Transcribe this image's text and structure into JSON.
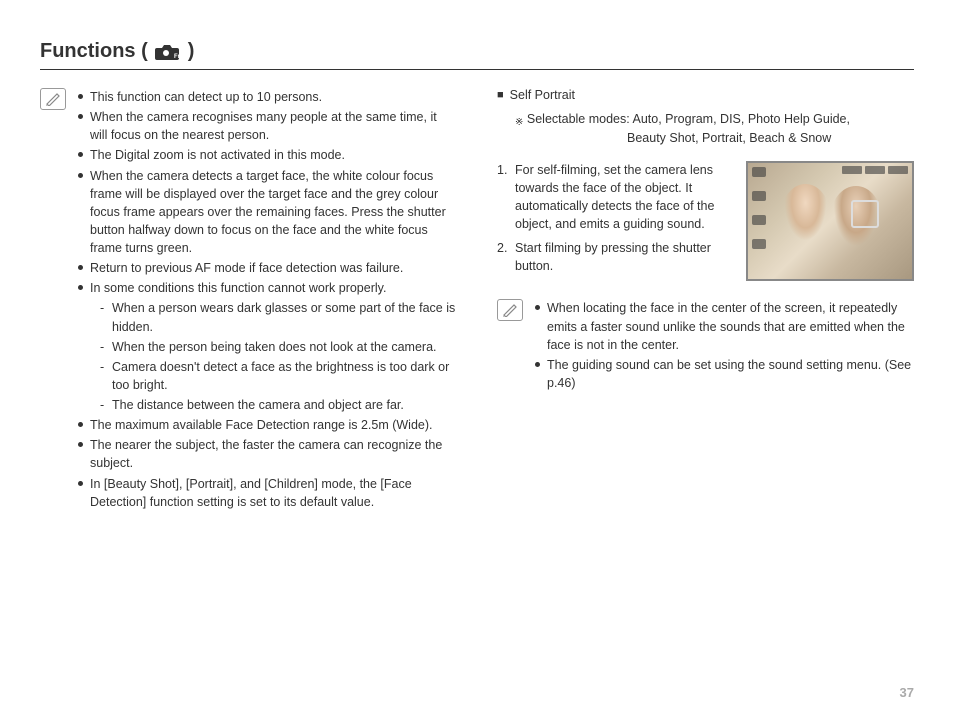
{
  "page_number": "37",
  "title": "Functions (",
  "title_close": ")",
  "left_notes": [
    "This function can detect up to 10 persons.",
    "When the camera recognises many people at the same time, it will focus on the nearest person.",
    "The Digital zoom is not activated in this mode.",
    "When the camera detects a target face, the white colour focus frame will be displayed over the target face and the grey colour focus frame appears over the remaining faces. Press the shutter button halfway down to focus on the face and the white focus frame turns green.",
    "Return to previous AF mode if face detection was failure.",
    "In some conditions this function cannot work properly."
  ],
  "left_sub": [
    "When a person wears dark glasses or some part of the face is hidden.",
    "When the person being taken does not look at the camera.",
    "Camera doesn't detect a face as the brightness is too dark or too bright.",
    "The distance between the camera and object are far."
  ],
  "left_notes2": [
    "The maximum available Face Detection range is 2.5m (Wide).",
    "The nearer the subject, the faster the camera can recognize the subject.",
    "In [Beauty Shot], [Portrait], and [Children] mode, the [Face Detection] function setting is set to its default value."
  ],
  "right_section": "Self Portrait",
  "modes_label": "Selectable modes: ",
  "modes_line1": "Auto, Program, DIS, Photo Help Guide,",
  "modes_line2": "Beauty Shot, Portrait, Beach & Snow",
  "steps": [
    "For self-filming, set the camera lens towards the face of the object. It automatically detects the face of the object, and emits a guiding sound.",
    "Start filming by pressing the shutter button."
  ],
  "right_notes": [
    "When locating the face in the center of the screen, it repeatedly emits a faster sound unlike the sounds that are emitted when the face is not in the center.",
    "The guiding sound can be set using the sound setting menu. (See p.46)"
  ]
}
